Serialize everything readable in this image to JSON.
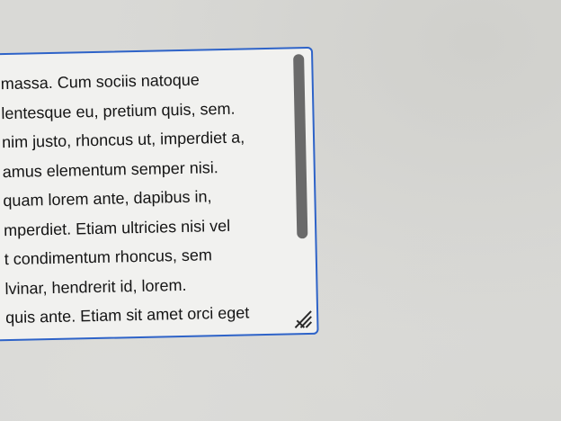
{
  "textarea": {
    "lines": [
      "massa. Cum sociis natoque",
      "lentesque eu, pretium quis, sem.",
      "nim justo, rhoncus ut, imperdiet a,",
      "amus elementum semper nisi.",
      "quam lorem ante, dapibus in,",
      "mperdiet. Etiam ultricies nisi vel",
      "t condimentum rhoncus, sem",
      "lvinar, hendrerit id, lorem.",
      "quis ante. Etiam sit amet orci eget"
    ],
    "border_color": "#2e63c8",
    "scroll_position": 0.0
  },
  "icons": {
    "resize": "resize-handle-icon"
  }
}
